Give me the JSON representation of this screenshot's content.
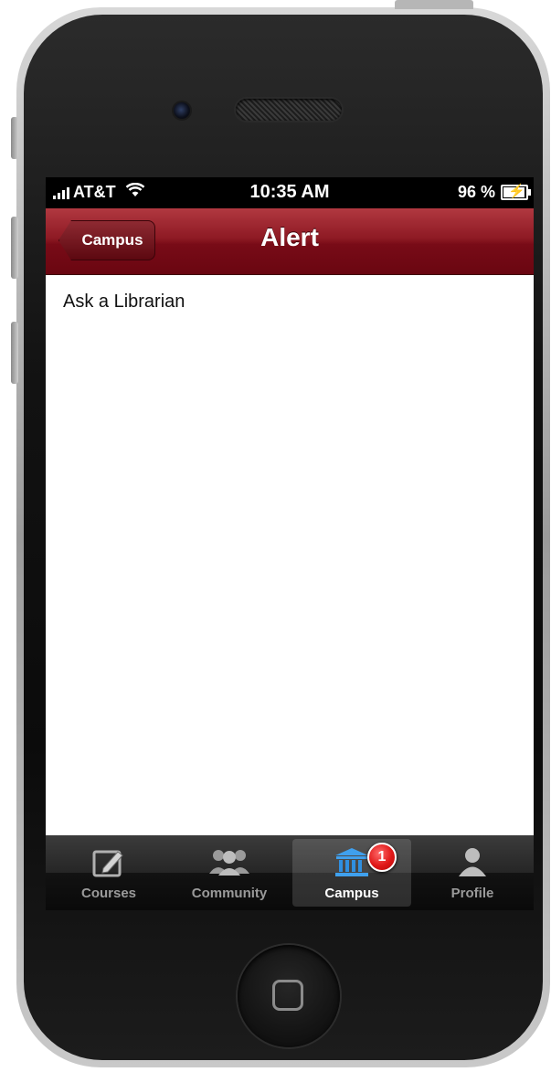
{
  "status_bar": {
    "carrier": "AT&T",
    "time": "10:35 AM",
    "battery": "96 %"
  },
  "nav": {
    "back_label": "Campus",
    "title": "Alert"
  },
  "content": {
    "label": "Ask a Librarian"
  },
  "tab_bar": {
    "tabs": [
      {
        "label": "Courses",
        "icon": "compose-icon"
      },
      {
        "label": "Community",
        "icon": "community-icon"
      },
      {
        "label": "Campus",
        "icon": "campus-building-icon",
        "badge": "1"
      },
      {
        "label": "Profile",
        "icon": "profile-icon"
      }
    ],
    "active_index": 2
  },
  "colors": {
    "nav_accent": "#8e1a24",
    "active_tab_icon": "#2f8fe0",
    "badge": "#e01818"
  }
}
